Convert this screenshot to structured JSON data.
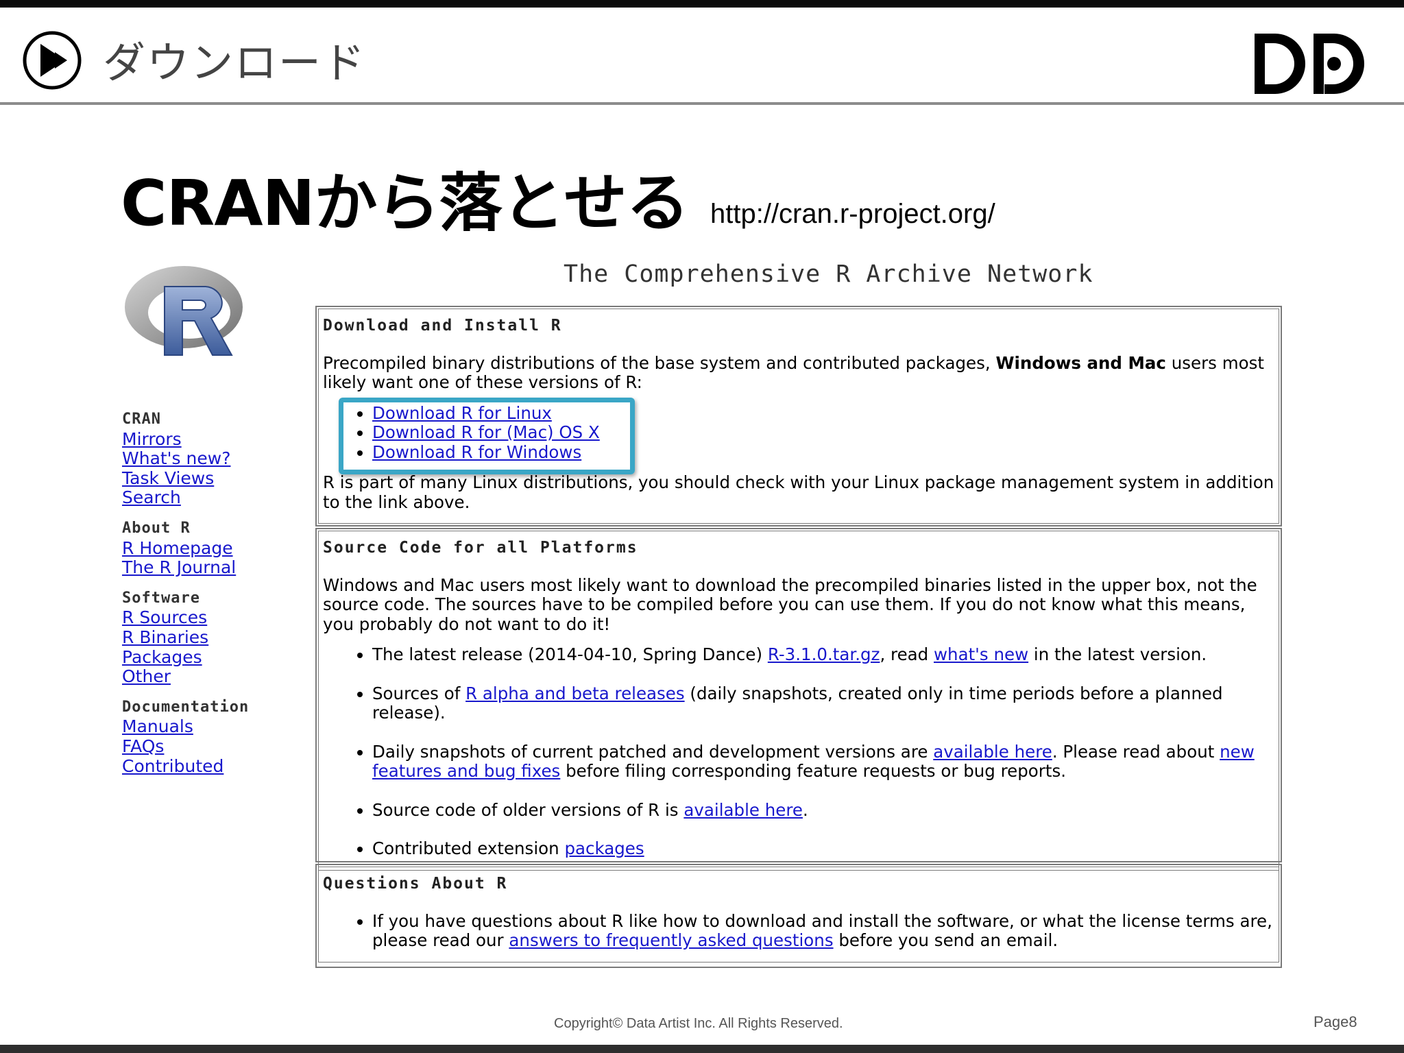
{
  "header": {
    "title": "ダウンロード"
  },
  "slide": {
    "title": "CRANから落とせる",
    "url": "http://cran.r-project.org/"
  },
  "cran": {
    "page_title": "The Comprehensive R Archive Network",
    "sidebar": {
      "groups": [
        {
          "title": "CRAN",
          "items": [
            "Mirrors",
            "What's new?",
            "Task Views",
            "Search"
          ]
        },
        {
          "title": "About R",
          "items": [
            "R Homepage",
            "The R Journal"
          ]
        },
        {
          "title": "Software",
          "items": [
            "R Sources",
            "R Binaries",
            "Packages",
            "Other"
          ]
        },
        {
          "title": "Documentation",
          "items": [
            "Manuals",
            "FAQs",
            "Contributed"
          ]
        }
      ]
    },
    "download": {
      "title": "Download and Install R",
      "intro_pre": "Precompiled binary distributions of the base system and contributed packages, ",
      "intro_bold": "Windows and Mac",
      "intro_post": " users most likely want one of these versions of R:",
      "links": [
        "Download R for Linux",
        "Download R for (Mac) OS X",
        "Download R for Windows"
      ],
      "note": "R is part of many Linux distributions, you should check with your Linux package management system in addition to the link above."
    },
    "source": {
      "title": "Source Code for all Platforms",
      "intro": "Windows and Mac users most likely want to download the precompiled binaries listed in the upper box, not the source code. The sources have to be compiled before you can use them. If you do not know what this means, you probably do not want to do it!",
      "item1_pre": "The latest release (2014-04-10, Spring Dance) ",
      "item1_link1": "R-3.1.0.tar.gz",
      "item1_mid": ", read ",
      "item1_link2": "what's new",
      "item1_post": " in the latest version.",
      "item2_pre": "Sources of ",
      "item2_link": "R alpha and beta releases",
      "item2_post": " (daily snapshots, created only in time periods before a planned release).",
      "item3_pre": "Daily snapshots of current patched and development versions are ",
      "item3_link1": "available here",
      "item3_mid": ". Please read about ",
      "item3_link2": "new features and bug fixes",
      "item3_post": " before filing corresponding feature requests or bug reports.",
      "item4_pre": "Source code of older versions of R is ",
      "item4_link": "available here",
      "item4_post": ".",
      "item5_pre": "Contributed extension ",
      "item5_link": "packages"
    },
    "questions": {
      "title": "Questions About R",
      "item_pre": "If you have questions about R like how to download and install the software, or what the license terms are, please read our ",
      "item_link": "answers to frequently asked questions",
      "item_post": " before you send an email."
    }
  },
  "footer": {
    "copyright": "Copyright© Data Artist Inc.   All Rights Reserved.",
    "page": "Page8"
  },
  "colors": {
    "link": "#1818cc",
    "highlight": "#3aa6c6",
    "header_rule": "#8c8c8c"
  }
}
